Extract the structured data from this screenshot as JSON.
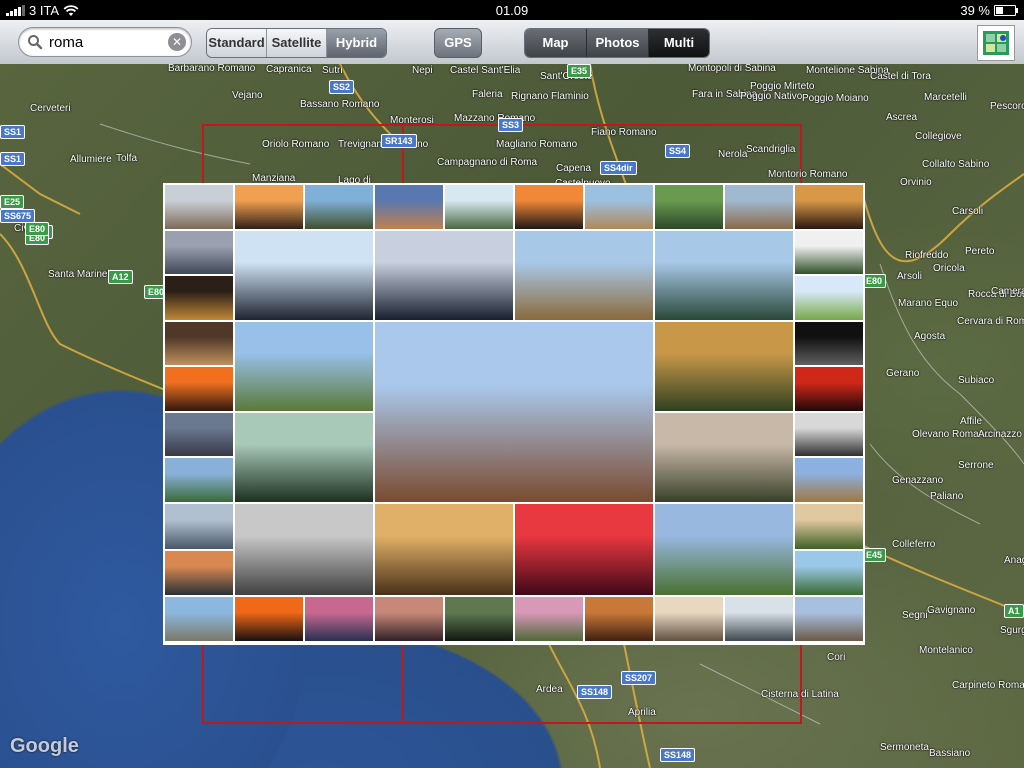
{
  "status": {
    "carrier": "3 ITA",
    "time": "01.09",
    "battery": "39 %",
    "battery_level": 0.39
  },
  "search": {
    "value": "roma",
    "placeholder": ""
  },
  "map_type": {
    "options": [
      {
        "label": "Standard",
        "selected": false
      },
      {
        "label": "Satellite",
        "selected": false
      },
      {
        "label": "Hybrid",
        "selected": true
      }
    ]
  },
  "gps_label": "GPS",
  "view_mode": {
    "options": [
      {
        "label": "Map",
        "selected": false
      },
      {
        "label": "Photos",
        "selected": false
      },
      {
        "label": "Multi",
        "selected": true
      }
    ]
  },
  "map": {
    "attribution": "Google",
    "places": [
      {
        "text": "Barbarano Romano"
      },
      {
        "text": "Capranica"
      },
      {
        "text": "Sutri"
      },
      {
        "text": "Nepi"
      },
      {
        "text": "Castel Sant'Elia"
      },
      {
        "text": "Sant'Oreste"
      },
      {
        "text": "Montopoli di Sabina"
      },
      {
        "text": "Poggio Mirteto"
      },
      {
        "text": "Montelione Sabina"
      },
      {
        "text": "Castel di Tora"
      },
      {
        "text": "Vejano"
      },
      {
        "text": "Bassano Romano"
      },
      {
        "text": "Faleria"
      },
      {
        "text": "Rignano Flaminio"
      },
      {
        "text": "Fara in Sabina"
      },
      {
        "text": "Poggio Nativo"
      },
      {
        "text": "Poggio Moiano"
      },
      {
        "text": "Marcetelli"
      },
      {
        "text": "Pescorocchiano"
      },
      {
        "text": "Ascrea"
      },
      {
        "text": "Monterosi"
      },
      {
        "text": "Mazzano Romano"
      },
      {
        "text": "Oriolo Romano"
      },
      {
        "text": "Trevignano Romano"
      },
      {
        "text": "Magliano Romano"
      },
      {
        "text": "Fiano Romano"
      },
      {
        "text": "Scandriglia"
      },
      {
        "text": "Collegiove"
      },
      {
        "text": "Allumiere"
      },
      {
        "text": "Tolfa"
      },
      {
        "text": "Campagnano di Roma"
      },
      {
        "text": "Capena"
      },
      {
        "text": "Nerola"
      },
      {
        "text": "Collalto Sabino"
      },
      {
        "text": "Manziana"
      },
      {
        "text": "Lago di"
      },
      {
        "text": "Castelnuovo"
      },
      {
        "text": "Montorio Romano"
      },
      {
        "text": "Orvinio"
      },
      {
        "text": "Carsoli"
      },
      {
        "text": "Santa Marinella"
      },
      {
        "text": "Civita"
      },
      {
        "text": "Riofreddo"
      },
      {
        "text": "Pereto"
      },
      {
        "text": "Oricola"
      },
      {
        "text": "Arsoli"
      },
      {
        "text": "Marano Equo"
      },
      {
        "text": "Rocca di Botte"
      },
      {
        "text": "Camerata Nuova"
      },
      {
        "text": "Agosta"
      },
      {
        "text": "Cervara di Roma"
      },
      {
        "text": "Gerano"
      },
      {
        "text": "Subiaco"
      },
      {
        "text": "Affile"
      },
      {
        "text": "Olevano Romano"
      },
      {
        "text": "Arcinazzo Romano"
      },
      {
        "text": "Serrone"
      },
      {
        "text": "Genazzano"
      },
      {
        "text": "Paliano"
      },
      {
        "text": "Colleferro"
      },
      {
        "text": "Anagni"
      },
      {
        "text": "Segni"
      },
      {
        "text": "Gavignano"
      },
      {
        "text": "Sgurgola"
      },
      {
        "text": "Montelanico"
      },
      {
        "text": "Carpineto Romano"
      },
      {
        "text": "Cori"
      },
      {
        "text": "Ardea"
      },
      {
        "text": "Aprilia"
      },
      {
        "text": "Cisterna di Latina"
      },
      {
        "text": "Sermoneta"
      },
      {
        "text": "Bassiano"
      },
      {
        "text": "Cerveteri"
      }
    ],
    "roads": [
      {
        "text": "E35"
      },
      {
        "text": "SS2"
      },
      {
        "text": "SS3"
      },
      {
        "text": "SR143"
      },
      {
        "text": "SS4dir"
      },
      {
        "text": "SS4"
      },
      {
        "text": "E80"
      },
      {
        "text": "SS1"
      },
      {
        "text": "SS1"
      },
      {
        "text": "E25"
      },
      {
        "text": "E80"
      },
      {
        "text": "A12"
      },
      {
        "text": "E80"
      },
      {
        "text": "E80"
      },
      {
        "text": "A1"
      },
      {
        "text": "E45"
      },
      {
        "text": "SS148"
      },
      {
        "text": "SS207"
      },
      {
        "text": "SS148"
      },
      {
        "text": "SS675"
      },
      {
        "text": "E80"
      }
    ]
  },
  "photos": [
    {
      "name": "airplane-photo",
      "c1": "#c9cfd6",
      "c2": "#7d6a58"
    },
    {
      "name": "streetlamp-sunset-photo",
      "c1": "#f0a050",
      "c2": "#302018"
    },
    {
      "name": "pampas-grass-photo",
      "c1": "#7fb0d8",
      "c2": "#40502c"
    },
    {
      "name": "city-dusk-photo",
      "c1": "#5a78b0",
      "c2": "#c08050"
    },
    {
      "name": "waterfall-photo",
      "c1": "#d8e8f0",
      "c2": "#4a6a40"
    },
    {
      "name": "sunset-horizon-photo",
      "c1": "#f08838",
      "c2": "#201818"
    },
    {
      "name": "colosseum-photo",
      "c1": "#9cc0e0",
      "c2": "#b08858"
    },
    {
      "name": "forest-waterfall-photo",
      "c1": "#6a9a50",
      "c2": "#2c4828"
    },
    {
      "name": "stone-buildings-photo",
      "c1": "#a0b8d0",
      "c2": "#8a6a48"
    },
    {
      "name": "candlelit-room-photo",
      "c1": "#d89848",
      "c2": "#2a1810"
    },
    {
      "name": "misty-lake-photo",
      "c1": "#9aa0b0",
      "c2": "#404858"
    },
    {
      "name": "obelisk-square-photo",
      "c1": "#cfe2f4",
      "c2": "#202430"
    },
    {
      "name": "pantheon-oculus-photo",
      "c1": "#c8d0e0",
      "c2": "#182030"
    },
    {
      "name": "sphere-sculpture-photo",
      "c1": "#a8c8e8",
      "c2": "#8a6a3a"
    },
    {
      "name": "river-bridge-photo",
      "c1": "#a8c8e8",
      "c2": "#2a4838"
    },
    {
      "name": "calla-lily-photo",
      "c1": "#f0f0f0",
      "c2": "#305028"
    },
    {
      "name": "city-night-photo",
      "c1": "#2a2018",
      "c2": "#c08838"
    },
    {
      "name": "lone-tree-photo",
      "c1": "#d8e8f8",
      "c2": "#78a848"
    },
    {
      "name": "restaurant-terrace-photo",
      "c1": "#503828",
      "c2": "#c09060"
    },
    {
      "name": "villa-garden-photo",
      "c1": "#98c0e8",
      "c2": "#5a7a38"
    },
    {
      "name": "roman-ruins-panorama-photo",
      "c1": "#aac8ec",
      "c2": "#7a4a30"
    },
    {
      "name": "castle-tower-sunset-photo",
      "c1": "#c89848",
      "c2": "#304020"
    },
    {
      "name": "wet-street-night-photo",
      "c1": "#101010",
      "c2": "#606060"
    },
    {
      "name": "boat-sunset-photo",
      "c1": "#f07020",
      "c2": "#301810"
    },
    {
      "name": "red-sky-photo",
      "c1": "#d02818",
      "c2": "#200808"
    },
    {
      "name": "lake-dusk-photo",
      "c1": "#6a7890",
      "c2": "#383848"
    },
    {
      "name": "garden-pond-photo",
      "c1": "#a8c8b8",
      "c2": "#1c3020"
    },
    {
      "name": "tree-alley-photo",
      "c1": "#c8b8a8",
      "c2": "#384028"
    },
    {
      "name": "bare-tree-bw-photo",
      "c1": "#d8d8d8",
      "c2": "#303030"
    },
    {
      "name": "island-coast-photo",
      "c1": "#88b0d8",
      "c2": "#3a6a38"
    },
    {
      "name": "hilltop-village-photo",
      "c1": "#8cb0e0",
      "c2": "#a07840"
    },
    {
      "name": "airplane-sky-photo",
      "c1": "#b0c0d0",
      "c2": "#485868"
    },
    {
      "name": "city-aerial-bw-photo",
      "c1": "#c8c8c8",
      "c2": "#404040"
    },
    {
      "name": "gallery-ceiling-photo",
      "c1": "#e0b068",
      "c2": "#483018"
    },
    {
      "name": "neon-arches-photo",
      "c1": "#e83840",
      "c2": "#400818"
    },
    {
      "name": "aqueduct-photo",
      "c1": "#98b8e0",
      "c2": "#4a7030"
    },
    {
      "name": "umbrella-pines-photo",
      "c1": "#e0c8a0",
      "c2": "#406028"
    },
    {
      "name": "harbor-boats-photo",
      "c1": "#d88850",
      "c2": "#283038"
    },
    {
      "name": "canal-reflection-photo",
      "c1": "#9ac8e8",
      "c2": "#3a6a30"
    },
    {
      "name": "seaside-town-photo",
      "c1": "#8cb8e0",
      "c2": "#7a7868"
    },
    {
      "name": "sunset-sea-photo",
      "c1": "#f06818",
      "c2": "#181010"
    },
    {
      "name": "purple-sunset-photo",
      "c1": "#c86890",
      "c2": "#283050"
    },
    {
      "name": "pink-dusk-photo",
      "c1": "#c88878",
      "c2": "#302028"
    },
    {
      "name": "pond-reflection-photo",
      "c1": "#607850",
      "c2": "#101810"
    },
    {
      "name": "flowering-path-photo",
      "c1": "#d898b8",
      "c2": "#506838"
    },
    {
      "name": "autumn-park-photo",
      "c1": "#c87838",
      "c2": "#402010"
    },
    {
      "name": "arcade-columns-photo",
      "c1": "#e8d8c0",
      "c2": "#605040"
    },
    {
      "name": "tornado-sea-photo",
      "c1": "#d8e0e8",
      "c2": "#404850"
    },
    {
      "name": "hill-town-photo",
      "c1": "#a8c0e0",
      "c2": "#6a5a48"
    }
  ]
}
